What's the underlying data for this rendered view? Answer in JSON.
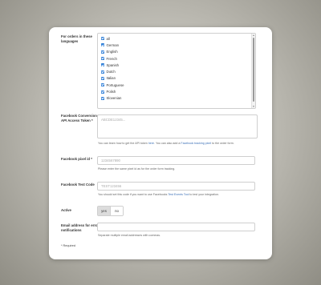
{
  "languages": {
    "label": "For orders in these languages",
    "items": [
      {
        "label": "all",
        "checked": true
      },
      {
        "label": "German",
        "checked": true
      },
      {
        "label": "English",
        "checked": true
      },
      {
        "label": "French",
        "checked": true
      },
      {
        "label": "Spanish",
        "checked": true
      },
      {
        "label": "Dutch",
        "checked": true
      },
      {
        "label": "Italian",
        "checked": true
      },
      {
        "label": "Portuguese",
        "checked": true
      },
      {
        "label": "Polish",
        "checked": true
      },
      {
        "label": "Slovenian",
        "checked": true
      }
    ]
  },
  "token": {
    "label": "Facebook Conversions API Access Token *",
    "placeholder": "ABCDE12345...",
    "help_prefix": "You can learn how to get the API token ",
    "help_link1": "here",
    "help_middle": ". You can also add a ",
    "help_link2": "Facebook tracking pixel",
    "help_suffix": " to the order form."
  },
  "pixel": {
    "label": "Facebook pixel id *",
    "placeholder": "1234567890",
    "help": "Please enter the same pixel id as for the order form tracking."
  },
  "test_code": {
    "label": "Facebook Test Code",
    "placeholder": "TEST123456",
    "help_prefix": "You should set this code if you want to use Facebooks ",
    "help_link": "Test Events Tool",
    "help_suffix": " to test your integration."
  },
  "active": {
    "label": "Active",
    "yes": "yes",
    "no": "no",
    "selected": "yes"
  },
  "email": {
    "label": "Email address for error notifications",
    "value": "",
    "help": "Separate multiple email addresses with commas."
  },
  "required_note": "* Required"
}
